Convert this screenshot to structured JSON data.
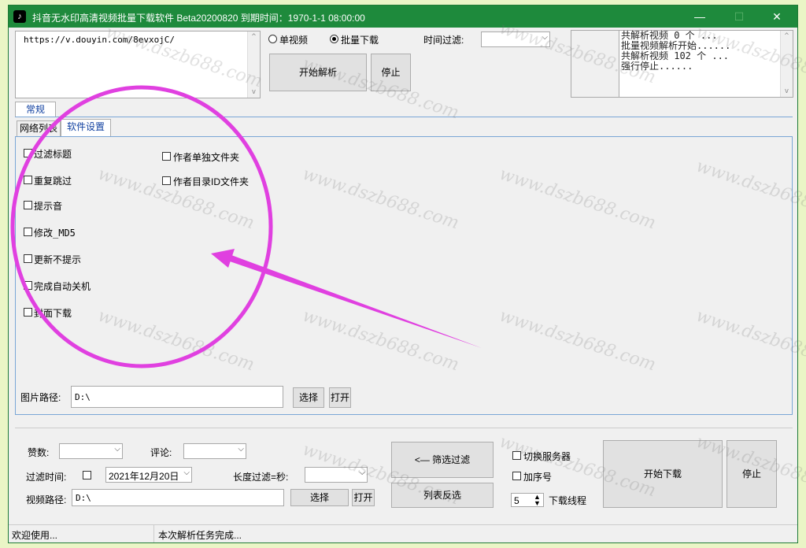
{
  "window": {
    "title": "抖音无水印高清视频批量下载软件 Beta20200820 到期时间：1970-1-1 08:00:00",
    "app_icon": "tiktok-icon",
    "min_label": "—",
    "max_label": "☐",
    "close_label": "✕"
  },
  "url_box": {
    "value": "https://v.douyin.com/8evxojC/"
  },
  "mode": {
    "single_label": "单视频",
    "batch_label": "批量下载",
    "selected": "batch"
  },
  "time_filter": {
    "label": "时间过滤:",
    "value": ""
  },
  "parse": {
    "start_label": "开始解析",
    "stop_label": "停止"
  },
  "log": {
    "lines": [
      "共解析视频 0 个 ...",
      "批量视频解析开始......",
      "共解析视频 102 个 ...",
      "强行停止......"
    ]
  },
  "top_tab": {
    "label": "常规"
  },
  "sub_tabs": {
    "list_label": "网络列表",
    "settings_label": "软件设置"
  },
  "settings": {
    "left": [
      "过滤标题",
      "重复跳过",
      "提示音",
      "修改_MD5",
      "更新不提示",
      "完成自动关机",
      "封面下载"
    ],
    "right": [
      "作者单独文件夹",
      "作者目录ID文件夹"
    ]
  },
  "image_path": {
    "label": "图片路径:",
    "value": "D:\\",
    "choose_label": "选择",
    "open_label": "打开"
  },
  "bottom": {
    "likes_label": "赞数:",
    "comments_label": "评论:",
    "filter_time_label": "过滤时间:",
    "date_value": "2021年12月20日",
    "length_filter_label": "长度过滤=秒:",
    "video_path_label": "视频路径:",
    "video_path_value": "D:\\",
    "choose_label": "选择",
    "open_label": "打开",
    "filter_button_label": "<— 筛选过滤",
    "invert_button_label": "列表反选",
    "switch_server_label": "切换服务器",
    "add_seq_label": "加序号",
    "threads_value": "5",
    "threads_label": "下载线程",
    "start_download_label": "开始下载",
    "stop_label": "停止"
  },
  "status": {
    "left": "欢迎使用...",
    "right": "本次解析任务完成..."
  },
  "watermark": {
    "text": "www.dszb688.com"
  },
  "colors": {
    "titlebar": "#1e8a3c",
    "annotation": "#e040e0",
    "background": "#eaf5c6"
  }
}
